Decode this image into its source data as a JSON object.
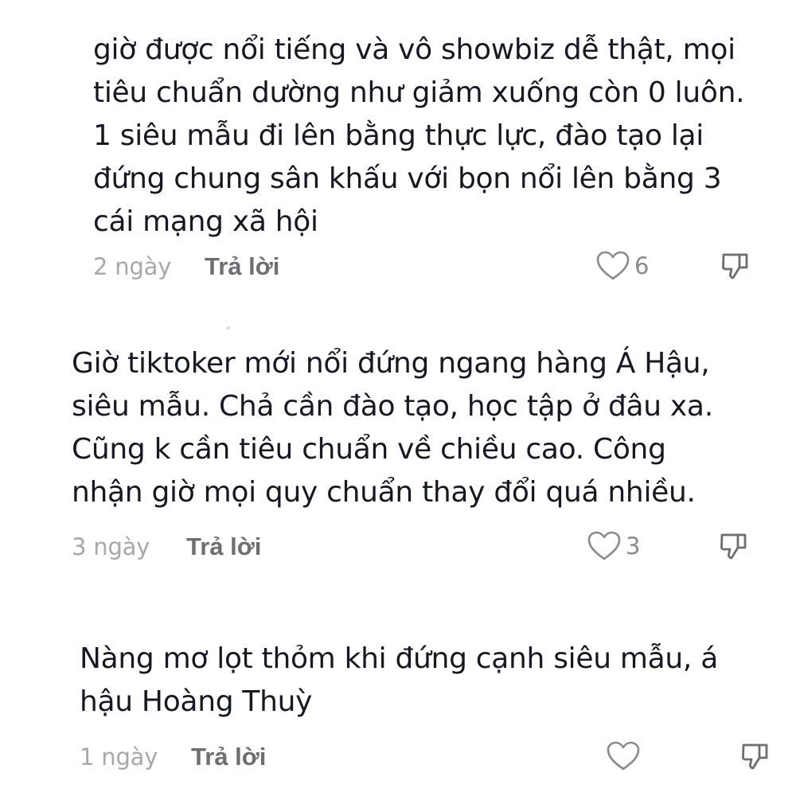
{
  "comments": [
    {
      "lines": [
        "giờ được nổi tiếng và vô showbiz dễ thật, mọi",
        "tiêu chuẩn dường như giảm xuống còn 0 luôn.",
        "1 siêu mẫu đi lên bằng thực lực, đào tạo lại",
        "đứng chung sân khấu với bọn nổi lên bằng 3",
        "cái mạng xã hội"
      ],
      "time": "2 ngày",
      "reply_label": "Trả lời",
      "like_count": "6",
      "like_icon": "heart-outline-icon",
      "dislike_icon": "thumbs-down-outline-icon"
    },
    {
      "lines": [
        "Giờ tiktoker mới nổi đứng ngang hàng Á Hậu,",
        "siêu mẫu. Chả cần đào tạo, học tập ở đâu xa.",
        "Cũng k cần tiêu chuẩn về chiều cao. Công",
        "nhận giờ mọi quy chuẩn thay đổi quá nhiều."
      ],
      "time": "3 ngày",
      "reply_label": "Trả lời",
      "like_count": "3",
      "like_icon": "heart-outline-icon",
      "dislike_icon": "thumbs-down-outline-icon"
    },
    {
      "lines": [
        "Nàng mơ lọt thỏm khi đứng cạnh siêu mẫu, á",
        "hậu Hoàng Thuỳ"
      ],
      "time": "1 ngày",
      "reply_label": "Trả lời",
      "like_count": "",
      "like_icon": "heart-outline-icon",
      "dislike_icon": "thumbs-down-outline-icon"
    }
  ],
  "colors": {
    "text": "#161823",
    "time": "#a8a8ab",
    "reply": "#6e6e72",
    "icon": "#8a8a8f"
  }
}
